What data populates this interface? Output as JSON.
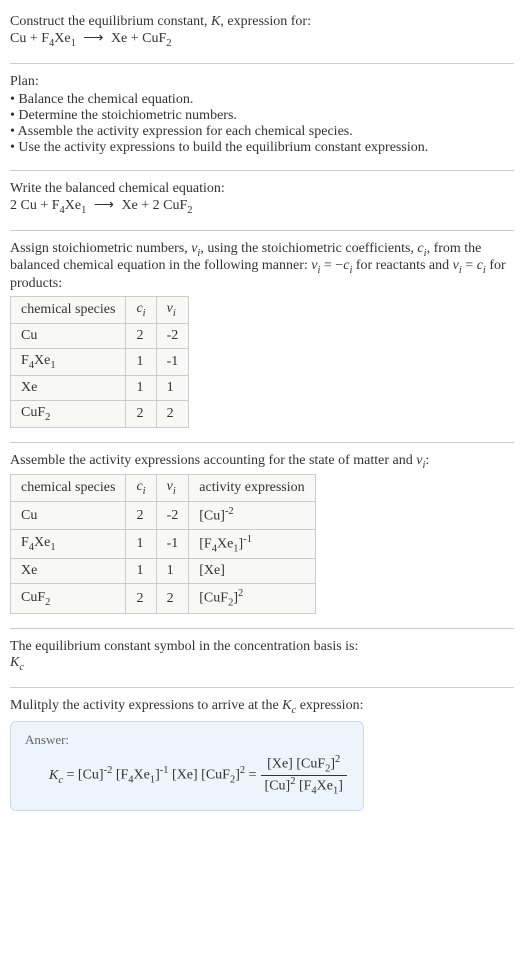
{
  "intro": {
    "line1": "Construct the equilibrium constant, K, expression for:",
    "eqn": "Cu + F₄Xe₁ ⟶ Xe + CuF₂"
  },
  "plan": {
    "heading": "Plan:",
    "items": [
      "Balance the chemical equation.",
      "Determine the stoichiometric numbers.",
      "Assemble the activity expression for each chemical species.",
      "Use the activity expressions to build the equilibrium constant expression."
    ]
  },
  "balanced": {
    "heading": "Write the balanced chemical equation:",
    "eqn": "2 Cu + F₄Xe₁ ⟶ Xe + 2 CuF₂"
  },
  "assign": {
    "text": "Assign stoichiometric numbers, νᵢ, using the stoichiometric coefficients, cᵢ, from the balanced chemical equation in the following manner: νᵢ = −cᵢ for reactants and νᵢ = cᵢ for products:",
    "headers": [
      "chemical species",
      "cᵢ",
      "νᵢ"
    ],
    "rows": [
      {
        "sp": "Cu",
        "c": "2",
        "v": "-2"
      },
      {
        "sp": "F₄Xe₁",
        "c": "1",
        "v": "-1"
      },
      {
        "sp": "Xe",
        "c": "1",
        "v": "1"
      },
      {
        "sp": "CuF₂",
        "c": "2",
        "v": "2"
      }
    ]
  },
  "activity": {
    "text": "Assemble the activity expressions accounting for the state of matter and νᵢ:",
    "headers": [
      "chemical species",
      "cᵢ",
      "νᵢ",
      "activity expression"
    ],
    "rows": [
      {
        "sp": "Cu",
        "c": "2",
        "v": "-2",
        "a": "[Cu]⁻²"
      },
      {
        "sp": "F₄Xe₁",
        "c": "1",
        "v": "-1",
        "a": "[F₄Xe₁]⁻¹"
      },
      {
        "sp": "Xe",
        "c": "1",
        "v": "1",
        "a": "[Xe]"
      },
      {
        "sp": "CuF₂",
        "c": "2",
        "v": "2",
        "a": "[CuF₂]²"
      }
    ]
  },
  "symbol": {
    "line1": "The equilibrium constant symbol in the concentration basis is:",
    "line2": "K_c"
  },
  "multiply": {
    "text": "Mulitply the activity expressions to arrive at the K_c expression:"
  },
  "answer": {
    "label": "Answer:",
    "lhs": "K_c = [Cu]⁻² [F₄Xe₁]⁻¹ [Xe] [CuF₂]² =",
    "num": "[Xe] [CuF₂]²",
    "den": "[Cu]² [F₄Xe₁]"
  }
}
